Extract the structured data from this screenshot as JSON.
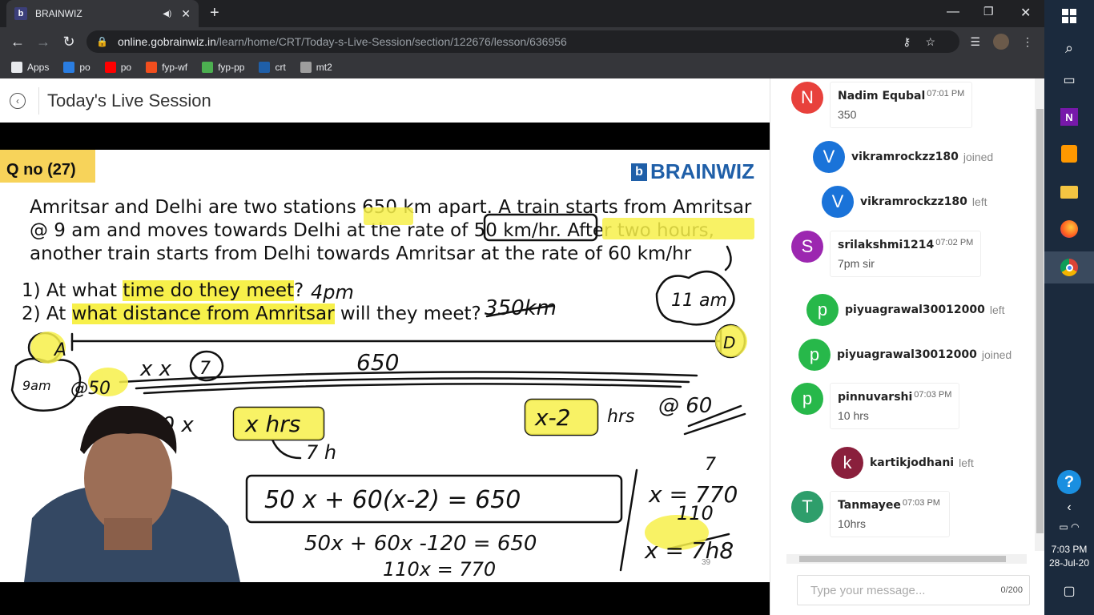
{
  "browser": {
    "tab_title": "BRAINWIZ",
    "tab_favicon": "b",
    "url_host": "online.gobrainwiz.in",
    "url_path": "/learn/home/CRT/Today-s-Live-Session/section/122676/lesson/636956",
    "bookmarks": [
      {
        "label": "Apps",
        "icon": "apps-grid",
        "color": "#e8eaed"
      },
      {
        "label": "po",
        "icon": "edge",
        "color": "#2a7de1"
      },
      {
        "label": "po",
        "icon": "youtube",
        "color": "#ff0000"
      },
      {
        "label": "fyp-wf",
        "icon": "figma",
        "color": "#f24e1e"
      },
      {
        "label": "fyp-pp",
        "icon": "pdf",
        "color": "#4caf50"
      },
      {
        "label": "crt",
        "icon": "brainwiz",
        "color": "#1f5fa8"
      },
      {
        "label": "mt2",
        "icon": "cc",
        "color": "#9e9e9e"
      }
    ]
  },
  "page": {
    "title": "Today's Live Session"
  },
  "slide": {
    "qno": "Q no (27)",
    "logo": "BRAINWIZ",
    "question_line1": "Amritsar and Delhi are two stations 650 km apart. A train starts from Amritsar",
    "question_line2": "@ 9 am and moves towards Delhi at the rate of 50 km/hr. After two hours,",
    "question_line3": "another train starts from Delhi towards Amritsar at the rate of 60 km/hr",
    "q1_pre": "1) At what ",
    "q1_hl": "time do they meet",
    "q1_post": "?",
    "q2_pre": "2) At ",
    "q2_hl": "what distance from Amritsar",
    "q2_post": " will they meet?",
    "page_number": "39",
    "accent": "#f7f04a"
  },
  "chat": {
    "items": [
      {
        "type": "message",
        "initial": "N",
        "color": "#e8413c",
        "name": "Nadim Equbal",
        "time": "07:01 PM",
        "text": "350"
      },
      {
        "type": "event",
        "initial": "V",
        "color": "#1a73d9",
        "name": "vikramrockzz180",
        "action": "joined"
      },
      {
        "type": "event",
        "initial": "V",
        "color": "#1a73d9",
        "name": "vikramrockzz180",
        "action": "left"
      },
      {
        "type": "message",
        "initial": "S",
        "color": "#9c27b0",
        "name": "srilakshmi1214",
        "time": "07:02 PM",
        "text": "7pm sir"
      },
      {
        "type": "event",
        "initial": "p",
        "color": "#27b84a",
        "name": "piyuagrawal30012000",
        "action": "left"
      },
      {
        "type": "event",
        "initial": "p",
        "color": "#27b84a",
        "name": "piyuagrawal30012000",
        "action": "joined"
      },
      {
        "type": "message",
        "initial": "p",
        "color": "#27b84a",
        "name": "pinnuvarshi",
        "time": "07:03 PM",
        "text": "10 hrs"
      },
      {
        "type": "event",
        "initial": "k",
        "color": "#8a1f3c",
        "name": "kartikjodhani",
        "action": "left"
      },
      {
        "type": "message",
        "initial": "T",
        "color": "#2e9e6b",
        "name": "Tanmayee",
        "time": "07:03 PM",
        "text": "10hrs"
      }
    ],
    "input_placeholder": "Type your message...",
    "counter": "0/200"
  },
  "taskbar": {
    "time": "7:03 PM",
    "date": "28-Jul-20"
  }
}
